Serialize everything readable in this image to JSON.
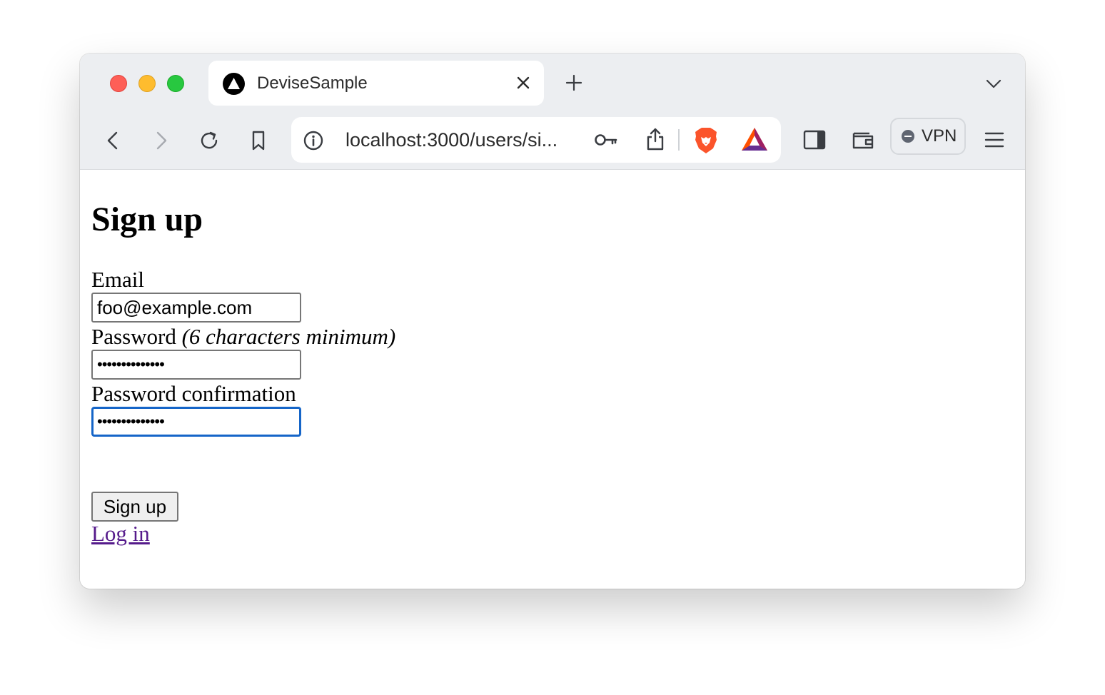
{
  "browser": {
    "tab": {
      "title": "DeviseSample",
      "favicon": "triangle-logo-icon"
    },
    "address_bar": {
      "url": "localhost:3000/users/si..."
    },
    "vpn_label": "VPN",
    "icons": [
      "back-arrow-icon",
      "forward-arrow-icon",
      "reload-icon",
      "bookmark-icon",
      "info-icon",
      "key-icon",
      "share-icon",
      "brave-lion-icon",
      "bat-triangle-icon",
      "sidebar-icon",
      "wallet-icon",
      "menu-icon"
    ]
  },
  "page": {
    "title": "Sign up",
    "email": {
      "label": "Email",
      "value": "foo@example.com"
    },
    "password": {
      "label": "Password",
      "hint": "(6 characters minimum)",
      "masked_value": "••••••••••••••"
    },
    "password_confirmation": {
      "label": "Password confirmation",
      "masked_value": "••••••••••••••"
    },
    "submit_label": "Sign up",
    "login_link": "Log in"
  },
  "colors": {
    "focus_ring": "#1565c8",
    "visited_link": "#551a8b",
    "traffic_red": "#fe5f57",
    "traffic_yellow": "#febc2e",
    "traffic_green": "#28c840"
  }
}
